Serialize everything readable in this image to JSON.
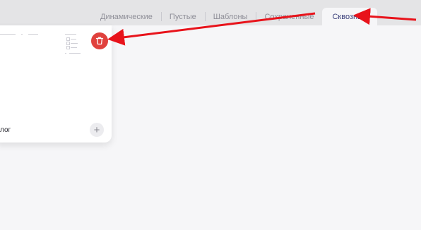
{
  "tabs": [
    {
      "label": "Динамические",
      "active": false
    },
    {
      "label": "Пустые",
      "active": false
    },
    {
      "label": "Шаблоны",
      "active": false
    },
    {
      "label": "Сохраненные",
      "active": false
    },
    {
      "label": "Сквозные",
      "active": true
    }
  ],
  "card": {
    "label": "лог",
    "delete_icon": "trash-icon",
    "add_icon": "plus-icon",
    "add_symbol": "+"
  },
  "colors": {
    "accent": "#3a3f7a",
    "delete": "#e0413d",
    "annotation": "#e8131b"
  }
}
